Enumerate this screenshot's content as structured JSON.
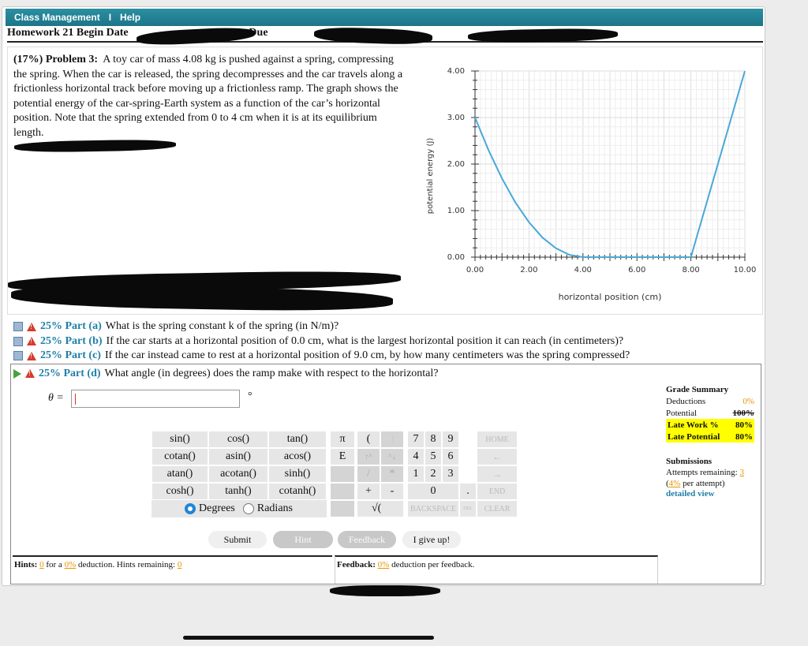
{
  "topbar": {
    "class_management": "Class Management",
    "separator": "I",
    "help": "Help"
  },
  "homework_title": "Homework 21 Begin Date",
  "homework_title_mid": "-- Due",
  "problem": {
    "label": "(17%)  Problem 3:",
    "text": "A toy car of mass 4.08 kg is pushed against a spring, compressing the spring. When the car is released, the spring decompresses and the car travels along a frictionless horizontal track before moving up a frictionless ramp. The graph shows the potential energy of the car-spring-Earth system as a function of the car’s horizontal position. Note that the spring extended from 0 to 4 cm when it is at its equilibrium length."
  },
  "chart_data": {
    "type": "line",
    "xlabel": "horizontal position (cm)",
    "ylabel": "potential energy (J)",
    "xlim": [
      0,
      10
    ],
    "ylim": [
      0,
      4
    ],
    "x_ticks": [
      "0.00",
      "2.00",
      "4.00",
      "6.00",
      "8.00",
      "10.00"
    ],
    "y_ticks": [
      "0.00",
      "1.00",
      "2.00",
      "3.00",
      "4.00"
    ],
    "grid": true,
    "color": "#4aa8d8",
    "series": [
      {
        "x": [
          0,
          0.5,
          1,
          1.5,
          2,
          2.5,
          3,
          3.5,
          4
        ],
        "y": [
          3.0,
          2.3,
          1.69,
          1.17,
          0.75,
          0.42,
          0.19,
          0.05,
          0.0
        ]
      },
      {
        "x": [
          4,
          8
        ],
        "y": [
          0,
          0
        ]
      },
      {
        "x": [
          8,
          10
        ],
        "y": [
          0,
          4.0
        ]
      }
    ]
  },
  "parts": [
    {
      "pct": "25% Part (a)",
      "q": "What is the spring constant k of the spring (in N/m)?"
    },
    {
      "pct": "25% Part (b)",
      "q": "If the car starts at a horizontal position of 0.0 cm, what is the largest horizontal position it can reach (in centimeters)?"
    },
    {
      "pct": "25% Part (c)",
      "q": "If the car instead came to rest at a horizontal position of 9.0 cm, by how many centimeters was the spring compressed?"
    },
    {
      "pct": "25% Part (d)",
      "q": "What angle (in degrees) does the ramp make with respect to the horizontal?"
    }
  ],
  "answer": {
    "label": "θ =",
    "unit": "°",
    "value": ""
  },
  "keypad": {
    "functions": [
      [
        "sin()",
        "cos()",
        "tan()"
      ],
      [
        "cotan()",
        "asin()",
        "acos()"
      ],
      [
        "atan()",
        "acotan()",
        "sinh()"
      ],
      [
        "cosh()",
        "tanh()",
        "cotanh()"
      ]
    ],
    "pi": "π",
    "e": "E",
    "lparen": "(",
    "rparen": ")",
    "up": "↑^",
    "down": "^↓",
    "slash": "/",
    "star": "*",
    "plus": "+",
    "minus": "-",
    "sqrt": "√(",
    "digits": [
      "7",
      "8",
      "9",
      "4",
      "5",
      "6",
      "1",
      "2",
      "3"
    ],
    "zero": "0",
    "dot": ".",
    "home": "HOME",
    "back_arrow": "←",
    "fwd_arrow": "→",
    "end": "END",
    "backspace": "BACKSPACE",
    "del": "DEL",
    "clear": "CLEAR",
    "degrees": "Degrees",
    "radians": "Radians"
  },
  "buttons": {
    "submit": "Submit",
    "hint": "Hint",
    "feedback": "Feedback",
    "give_up": "I give up!"
  },
  "hints": {
    "label": "Hints:",
    "count": "0",
    "for_a": "for a",
    "pct": "0%",
    "rest": "deduction. Hints remaining:",
    "remaining": "0"
  },
  "feedback": {
    "label": "Feedback:",
    "pct": "0%",
    "rest": "deduction per feedback."
  },
  "grade_summary": {
    "title": "Grade Summary",
    "deductions_label": "Deductions",
    "deductions": "0%",
    "potential_label": "Potential",
    "potential": "100%",
    "late_work_label": "Late Work %",
    "late_work": "80%",
    "late_potential_label": "Late Potential",
    "late_potential": "80%"
  },
  "submissions": {
    "title": "Submissions",
    "attempts_label": "Attempts remaining:",
    "attempts": "3",
    "per_attempt_pct": "4%",
    "per_attempt_rest": "per attempt)",
    "detailed_view": "detailed view"
  }
}
